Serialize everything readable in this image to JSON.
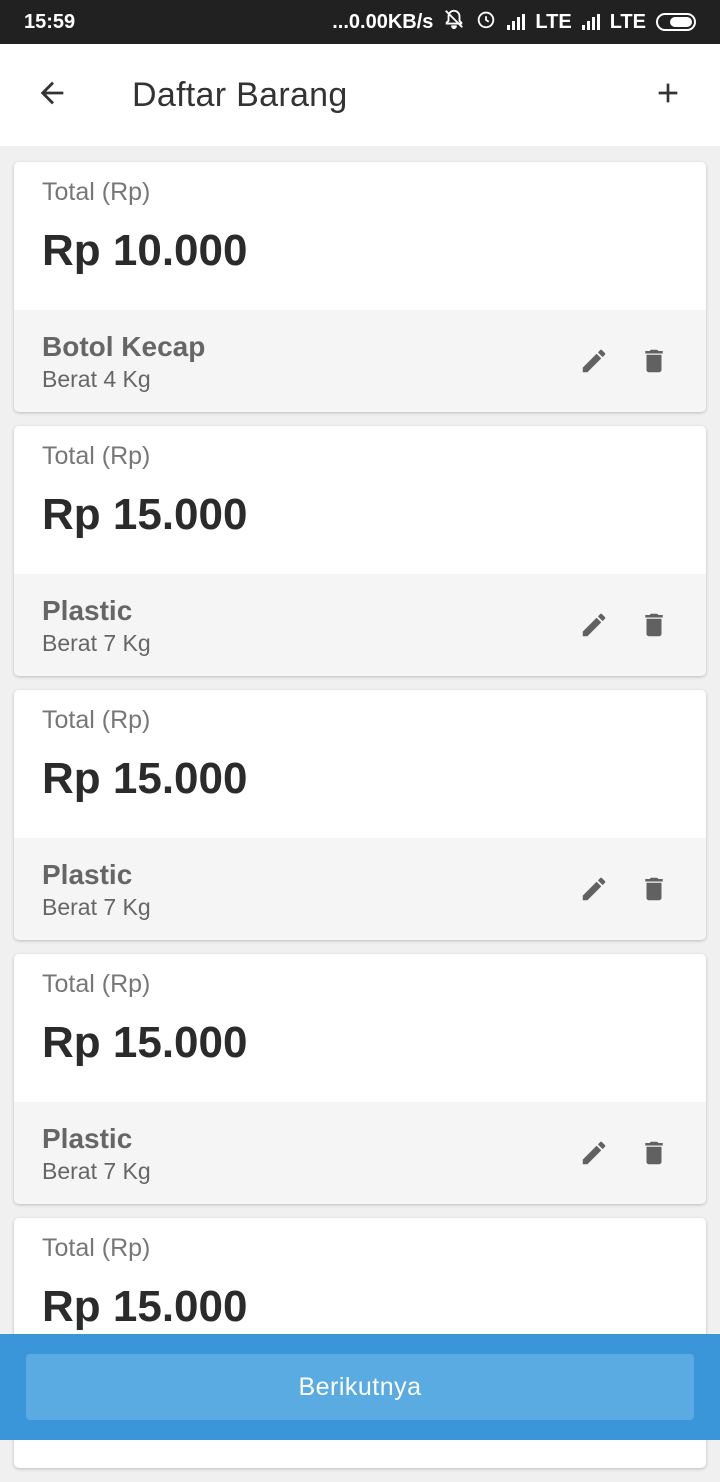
{
  "status_bar": {
    "time": "15:59",
    "network_speed": "...0.00KB/s",
    "network1": "LTE",
    "network2": "LTE",
    "icons": [
      "muted-bell-icon",
      "alarm-icon",
      "signal-icon",
      "signal-icon",
      "battery-icon"
    ]
  },
  "app_bar": {
    "title": "Daftar Barang",
    "back_icon": "arrow-left-icon",
    "add_icon": "plus-icon"
  },
  "items": [
    {
      "total_label": "Total (Rp)",
      "total_value": "Rp 10.000",
      "name": "Botol Kecap",
      "weight": "Berat 4 Kg"
    },
    {
      "total_label": "Total (Rp)",
      "total_value": "Rp 15.000",
      "name": "Plastic",
      "weight": "Berat 7 Kg"
    },
    {
      "total_label": "Total (Rp)",
      "total_value": "Rp 15.000",
      "name": "Plastic",
      "weight": "Berat 7 Kg"
    },
    {
      "total_label": "Total (Rp)",
      "total_value": "Rp 15.000",
      "name": "Plastic",
      "weight": "Berat 7 Kg"
    },
    {
      "total_label": "Total (Rp)",
      "total_value": "Rp 15.000"
    }
  ],
  "footer": {
    "next_label": "Berikutnya"
  },
  "colors": {
    "status_bar_bg": "#212121",
    "primary": "#3a96d8",
    "button": "#5aabe2",
    "icon_gray": "#616161"
  }
}
